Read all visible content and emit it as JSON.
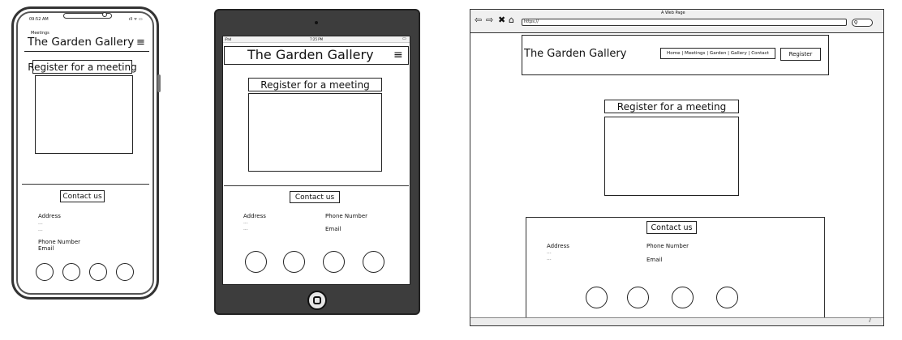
{
  "site": {
    "title": "The Garden Gallery",
    "menu_icon": "hamburger-icon",
    "register_heading": "Register for a meeting",
    "contact_heading": "Contact us",
    "address_label": "Address",
    "placeholder_line": "...",
    "phone_label": "Phone Number",
    "email_label": "Email",
    "social_icon_count": 4
  },
  "phone": {
    "time": "09:52 AM",
    "status_icons": "signal-wifi-battery-icons",
    "page_label": "Meetings"
  },
  "tablet": {
    "carrier": "iPad",
    "time": "7:25 PM"
  },
  "browser": {
    "window_title": "A Web Page",
    "url": "https://",
    "nav_links": "Home | Meetings | Garden | Gallery | Contact",
    "register_button": "Register"
  }
}
